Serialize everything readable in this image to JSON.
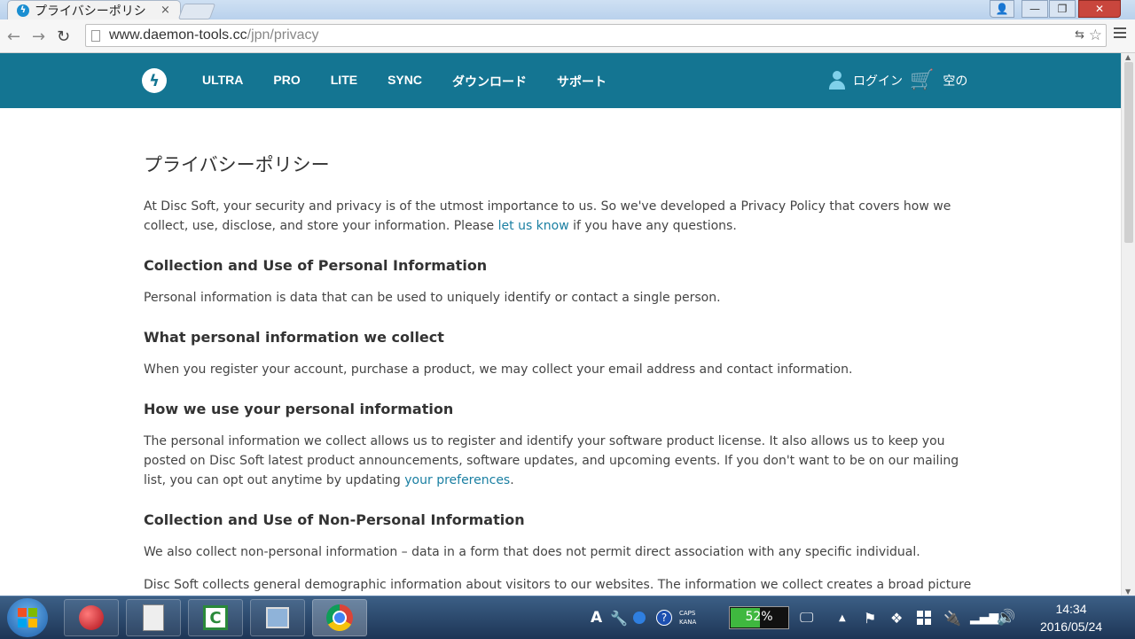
{
  "browser": {
    "tab_title": "プライバシーポリシ",
    "tab_close": "×",
    "url_host": "www.daemon-tools.cc",
    "url_path": "/jpn/privacy",
    "nav_back": "←",
    "nav_forward": "→",
    "nav_reload": "↻",
    "star": "☆",
    "translate": "⇆",
    "win_user": "👤",
    "win_min": "—",
    "win_max": "❐",
    "win_close": "✕"
  },
  "site": {
    "logo": "ϟ",
    "nav": [
      "ULTRA",
      "PRO",
      "LITE",
      "SYNC",
      "ダウンロード",
      "サポート"
    ],
    "login": "ログイン",
    "cart": "空の",
    "cart_icon": "🛒"
  },
  "page": {
    "title": "プライバシーポリシー",
    "intro_a": "At Disc Soft, your security and privacy is of the utmost importance to us. So we've developed a Privacy Policy that covers how we collect, use, disclose, and store your information. Please ",
    "intro_link": "let us know",
    "intro_b": " if you have any questions.",
    "h_collection": "Collection and Use of Personal Information",
    "p_collection": "Personal information is data that can be used to uniquely identify or contact a single person.",
    "h_what": "What personal information we collect",
    "p_what": "When you register your account, purchase a product, we may collect your email address and contact information.",
    "h_how": "How we use your personal information",
    "p_how_a": "The personal information we collect allows us to register and identify your software product license. It also allows us to keep you posted on Disc Soft latest product announcements, software updates, and upcoming events. If you don't want to be on our mailing list, you can opt out anytime by updating ",
    "p_how_link": "your preferences",
    "p_how_b": ".",
    "h_nonpersonal": "Collection and Use of Non-Personal Information",
    "p_nonpersonal": "We also collect non-personal information – data in a form that does not permit direct association with any specific individual.",
    "p_demographic": "Disc Soft collects general demographic information about visitors to our websites. The information we collect creates a broad picture of our population rather than focusing on any one individual. This information is used to continually refine our products and to identify the most popular areas of our websites."
  },
  "taskbar": {
    "ime": "A",
    "tool": "🔧",
    "help": "?",
    "caps": "CAPS",
    "kana": "KANA",
    "battery_percent": 52,
    "battery_label": "52%",
    "monitor": "🖵",
    "show_hidden": "▲",
    "flag": "⚑",
    "dropbox": "❖",
    "plug": "🔌",
    "signal": "▂▄▆",
    "speaker": "🔊",
    "time": "14:34",
    "date": "2016/05/24",
    "camt": "C"
  },
  "colors": {
    "header_bg": "#147592",
    "link": "#1a7fa2",
    "battery": "#3fb83f"
  }
}
